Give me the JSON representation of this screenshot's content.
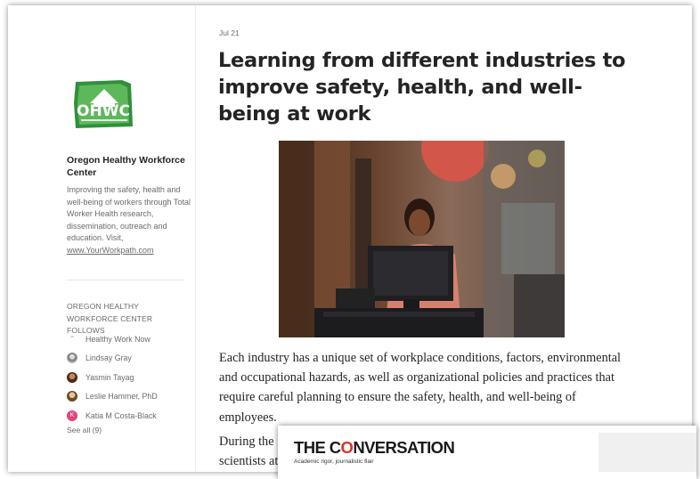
{
  "sidebar": {
    "logo_text": "OHWC",
    "org_name": "Oregon Healthy Workforce Center",
    "description": "Improving the safety, health and well-being of workers through Total Worker Health research, dissemination, outreach and education. Visit, ",
    "link_text": "www.YourWorkpath.com",
    "follows_title": "OREGON HEALTHY WORKFORCE CENTER FOLLOWS",
    "follows": [
      {
        "name": "Healthy Work Now",
        "avatar": "leaf-icon"
      },
      {
        "name": "Lindsay Gray",
        "avatar": "photo"
      },
      {
        "name": "Yasmin Tayag",
        "avatar": "photo"
      },
      {
        "name": "Leslie Hammer, PhD",
        "avatar": "photo"
      },
      {
        "name": "Katia M Costa-Black",
        "avatar": "K"
      }
    ],
    "see_all": "See all (9)"
  },
  "article": {
    "date": "Jul 21",
    "title": "Learning from different industries to improve safety, health, and well-being at work",
    "paragraph1": "Each industry has a unique set of workplace conditions, factors, environmental and occupational hazards, as well as organizational policies and practices that require careful planning to ensure the safety, health, and well-being of employees.",
    "paragraph2_start": "During the",
    "paragraph2_line2": "scientists at"
  },
  "overlay": {
    "brand_pre": "THE C",
    "brand_o": "O",
    "brand_post": "NVERSATION",
    "tagline": "Academic rigor, journalistic flair"
  },
  "colors": {
    "brand_red": "#d8352a",
    "logo_green": "#2f8f3a",
    "katia_avatar": "#e2437a"
  }
}
